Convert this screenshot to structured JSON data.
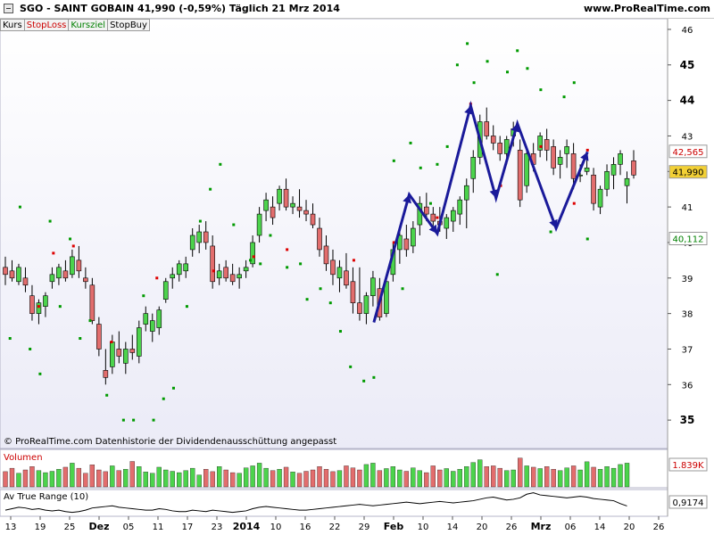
{
  "header": {
    "title": "SGO - SAINT GOBAIN    41,990 (-0,59%)    Täglich  21 Mrz 2014",
    "site": "www.ProRealTime.com"
  },
  "tabs": [
    {
      "label": "Kurs",
      "color": "#000000"
    },
    {
      "label": "StopLoss",
      "color": "#cc0000"
    },
    {
      "label": "Kursziel",
      "color": "#008000"
    },
    {
      "label": "StopBuy",
      "color": "#000000"
    }
  ],
  "colors": {
    "up": "#4cd34c",
    "down": "#e26d6d",
    "zigzag": "#1a1a9a",
    "stop_dot": "#009a00",
    "red_dot": "#dd0000",
    "panel_bg": "#ebebf7",
    "atr_line": "#000000"
  },
  "chart_data": {
    "type": "candlestick",
    "price_axis": {
      "ticks": [
        35,
        36,
        37,
        38,
        39,
        40,
        41,
        42,
        43,
        44,
        45,
        46
      ],
      "bold_ticks": [
        35,
        44,
        45
      ],
      "range": [
        34.2,
        46.3
      ]
    },
    "x_labels": [
      "13",
      "19",
      "25",
      "Dez",
      "05",
      "11",
      "17",
      "23",
      "2014",
      "10",
      "16",
      "22",
      "29",
      "Feb",
      "10",
      "14",
      "20",
      "26",
      "Mrz",
      "06",
      "14",
      "20",
      "26"
    ],
    "bold_x_labels": [
      "Dez",
      "2014",
      "Feb",
      "Mrz"
    ],
    "price_labels": [
      {
        "text": "42,565",
        "value": 42.565,
        "color": "#cc0000",
        "bg": "#ffffff"
      },
      {
        "text": "41,990",
        "value": 41.99,
        "color": "#000000",
        "bg": "#f2d035"
      },
      {
        "text": "40,112",
        "value": 40.112,
        "color": "#008000",
        "bg": "#ffffff"
      }
    ],
    "candles": [
      [
        39.3,
        39.6,
        38.8,
        39.1
      ],
      [
        39.2,
        39.5,
        38.9,
        39.0
      ],
      [
        38.9,
        39.4,
        38.8,
        39.3
      ],
      [
        39.0,
        39.3,
        38.6,
        38.8
      ],
      [
        38.5,
        38.8,
        37.8,
        38.0
      ],
      [
        38.0,
        38.4,
        37.7,
        38.3
      ],
      [
        38.2,
        38.6,
        37.9,
        38.5
      ],
      [
        38.9,
        39.3,
        38.7,
        39.1
      ],
      [
        39.0,
        39.4,
        38.8,
        39.3
      ],
      [
        39.2,
        39.5,
        38.9,
        39.0
      ],
      [
        39.1,
        39.8,
        39.0,
        39.6
      ],
      [
        39.5,
        39.9,
        39.0,
        39.2
      ],
      [
        39.0,
        39.3,
        38.7,
        38.9
      ],
      [
        38.8,
        39.0,
        37.7,
        37.8
      ],
      [
        37.7,
        37.9,
        36.8,
        37.0
      ],
      [
        36.4,
        37.0,
        36.0,
        36.2
      ],
      [
        36.5,
        37.4,
        36.3,
        37.2
      ],
      [
        37.0,
        37.5,
        36.6,
        36.8
      ],
      [
        36.6,
        37.2,
        36.3,
        37.0
      ],
      [
        37.0,
        37.4,
        36.7,
        36.9
      ],
      [
        36.8,
        37.8,
        36.6,
        37.6
      ],
      [
        37.7,
        38.2,
        37.5,
        38.0
      ],
      [
        37.5,
        38.0,
        37.2,
        37.8
      ],
      [
        37.6,
        38.2,
        37.4,
        38.1
      ],
      [
        38.4,
        39.0,
        38.3,
        38.9
      ],
      [
        39.0,
        39.3,
        38.7,
        39.1
      ],
      [
        39.1,
        39.5,
        38.9,
        39.4
      ],
      [
        39.2,
        39.6,
        39.0,
        39.4
      ],
      [
        39.8,
        40.4,
        39.6,
        40.2
      ],
      [
        40.0,
        40.5,
        39.7,
        40.3
      ],
      [
        40.3,
        40.6,
        39.8,
        40.0
      ],
      [
        39.9,
        40.2,
        38.7,
        38.9
      ],
      [
        39.0,
        39.4,
        38.8,
        39.2
      ],
      [
        39.3,
        39.5,
        38.9,
        39.0
      ],
      [
        39.1,
        39.4,
        38.8,
        38.9
      ],
      [
        39.0,
        39.3,
        38.7,
        39.1
      ],
      [
        39.2,
        39.5,
        39.0,
        39.3
      ],
      [
        39.4,
        40.2,
        39.3,
        40.0
      ],
      [
        40.2,
        41.0,
        40.0,
        40.8
      ],
      [
        40.9,
        41.4,
        40.6,
        41.2
      ],
      [
        41.0,
        41.3,
        40.5,
        40.7
      ],
      [
        41.1,
        41.6,
        40.9,
        41.5
      ],
      [
        41.5,
        41.8,
        40.9,
        41.0
      ],
      [
        41.0,
        41.3,
        40.8,
        41.1
      ],
      [
        41.0,
        41.5,
        40.7,
        40.9
      ],
      [
        40.9,
        41.2,
        40.6,
        40.8
      ],
      [
        40.8,
        41.1,
        40.4,
        40.5
      ],
      [
        40.4,
        40.7,
        39.6,
        39.8
      ],
      [
        39.9,
        40.2,
        39.2,
        39.4
      ],
      [
        39.5,
        39.8,
        38.8,
        39.1
      ],
      [
        39.0,
        39.5,
        38.6,
        39.3
      ],
      [
        39.2,
        39.7,
        38.7,
        38.8
      ],
      [
        38.9,
        39.3,
        38.0,
        38.3
      ],
      [
        38.3,
        39.3,
        37.8,
        38.0
      ],
      [
        38.0,
        38.6,
        37.7,
        38.5
      ],
      [
        38.5,
        39.2,
        38.2,
        39.0
      ],
      [
        38.7,
        39.0,
        37.8,
        37.9
      ],
      [
        38.0,
        39.1,
        37.9,
        38.9
      ],
      [
        39.1,
        40.0,
        38.9,
        39.8
      ],
      [
        39.8,
        40.4,
        39.4,
        40.2
      ],
      [
        40.1,
        40.5,
        39.6,
        39.8
      ],
      [
        39.9,
        40.6,
        39.7,
        40.4
      ],
      [
        40.5,
        41.3,
        40.2,
        41.1
      ],
      [
        41.0,
        41.4,
        40.6,
        40.8
      ],
      [
        40.8,
        41.0,
        40.4,
        40.6
      ],
      [
        40.6,
        41.0,
        40.3,
        40.5
      ],
      [
        40.4,
        40.8,
        40.1,
        40.7
      ],
      [
        40.6,
        41.0,
        40.3,
        40.9
      ],
      [
        40.8,
        41.3,
        40.5,
        41.2
      ],
      [
        41.2,
        41.8,
        40.4,
        41.6
      ],
      [
        41.8,
        42.6,
        41.4,
        42.4
      ],
      [
        42.4,
        43.6,
        42.2,
        43.4
      ],
      [
        43.4,
        43.8,
        42.9,
        43.0
      ],
      [
        43.0,
        43.3,
        42.6,
        42.8
      ],
      [
        42.8,
        43.0,
        42.3,
        42.5
      ],
      [
        42.5,
        43.0,
        42.2,
        42.9
      ],
      [
        43.0,
        43.4,
        42.7,
        43.2
      ],
      [
        42.6,
        42.9,
        41.0,
        41.2
      ],
      [
        41.6,
        42.7,
        41.4,
        42.5
      ],
      [
        42.5,
        42.8,
        42.0,
        42.2
      ],
      [
        42.6,
        43.1,
        42.4,
        43.0
      ],
      [
        42.9,
        43.2,
        42.3,
        42.6
      ],
      [
        42.7,
        42.9,
        41.9,
        42.1
      ],
      [
        42.2,
        42.6,
        41.8,
        42.4
      ],
      [
        42.5,
        42.9,
        42.1,
        42.7
      ],
      [
        42.5,
        42.8,
        41.5,
        41.8
      ],
      [
        41.9,
        42.2,
        41.7,
        41.9
      ],
      [
        42.0,
        42.4,
        41.9,
        42.1
      ],
      [
        41.9,
        42.1,
        40.9,
        41.1
      ],
      [
        41.0,
        41.6,
        40.8,
        41.5
      ],
      [
        41.5,
        42.2,
        41.3,
        42.0
      ],
      [
        41.9,
        42.4,
        41.5,
        42.2
      ],
      [
        42.2,
        42.6,
        41.9,
        42.5
      ],
      [
        41.6,
        42.0,
        41.1,
        41.8
      ],
      [
        42.3,
        42.6,
        41.8,
        41.9
      ]
    ],
    "zigzag": [
      [
        0.56,
        37.75
      ],
      [
        0.613,
        41.35
      ],
      [
        0.655,
        40.25
      ],
      [
        0.705,
        43.85
      ],
      [
        0.743,
        41.25
      ],
      [
        0.775,
        43.35
      ],
      [
        0.833,
        40.4
      ],
      [
        0.88,
        42.55
      ]
    ],
    "stop_dots": [
      [
        0.015,
        37.3
      ],
      [
        0.03,
        41.0
      ],
      [
        0.045,
        37.0
      ],
      [
        0.06,
        36.3
      ],
      [
        0.075,
        40.6
      ],
      [
        0.09,
        38.2
      ],
      [
        0.105,
        40.1
      ],
      [
        0.12,
        37.3
      ],
      [
        0.135,
        37.8
      ],
      [
        0.16,
        35.7
      ],
      [
        0.185,
        35.0
      ],
      [
        0.2,
        35.0
      ],
      [
        0.215,
        38.5
      ],
      [
        0.23,
        35.0
      ],
      [
        0.245,
        35.6
      ],
      [
        0.26,
        35.9
      ],
      [
        0.28,
        38.2
      ],
      [
        0.3,
        40.6
      ],
      [
        0.315,
        41.5
      ],
      [
        0.33,
        42.2
      ],
      [
        0.35,
        40.5
      ],
      [
        0.375,
        39.5
      ],
      [
        0.39,
        39.4
      ],
      [
        0.405,
        40.2
      ],
      [
        0.43,
        39.3
      ],
      [
        0.45,
        39.4
      ],
      [
        0.46,
        38.4
      ],
      [
        0.48,
        38.7
      ],
      [
        0.495,
        38.3
      ],
      [
        0.51,
        37.5
      ],
      [
        0.525,
        36.5
      ],
      [
        0.545,
        36.1
      ],
      [
        0.56,
        36.2
      ],
      [
        0.59,
        42.3
      ],
      [
        0.603,
        38.7
      ],
      [
        0.615,
        42.8
      ],
      [
        0.63,
        42.1
      ],
      [
        0.645,
        41.1
      ],
      [
        0.655,
        42.2
      ],
      [
        0.67,
        42.7
      ],
      [
        0.685,
        45.0
      ],
      [
        0.7,
        45.6
      ],
      [
        0.71,
        44.5
      ],
      [
        0.73,
        45.1
      ],
      [
        0.745,
        39.1
      ],
      [
        0.76,
        44.8
      ],
      [
        0.775,
        45.4
      ],
      [
        0.79,
        44.9
      ],
      [
        0.81,
        44.3
      ],
      [
        0.825,
        40.3
      ],
      [
        0.845,
        44.1
      ],
      [
        0.86,
        44.5
      ],
      [
        0.88,
        40.1
      ]
    ],
    "red_dots": [
      [
        0.058,
        38.2
      ],
      [
        0.08,
        39.7
      ],
      [
        0.11,
        39.9
      ],
      [
        0.167,
        37.2
      ],
      [
        0.235,
        39.0
      ],
      [
        0.32,
        39.2
      ],
      [
        0.38,
        39.6
      ],
      [
        0.43,
        39.8
      ],
      [
        0.53,
        39.5
      ],
      [
        0.59,
        40.0
      ],
      [
        0.655,
        40.7
      ],
      [
        0.705,
        43.9
      ],
      [
        0.75,
        41.6
      ],
      [
        0.81,
        42.7
      ],
      [
        0.86,
        41.1
      ],
      [
        0.88,
        42.6
      ]
    ],
    "copyright": "© ProRealTime.com  Datenhistorie der Dividendenausschüttung angepasst",
    "volume": {
      "label": "Volumen",
      "value_label": "1.839K",
      "values": [
        0.45,
        0.55,
        0.4,
        0.5,
        0.6,
        0.48,
        0.42,
        0.46,
        0.52,
        0.58,
        0.7,
        0.55,
        0.4,
        0.65,
        0.5,
        0.45,
        0.62,
        0.48,
        0.52,
        0.75,
        0.6,
        0.44,
        0.4,
        0.58,
        0.5,
        0.46,
        0.42,
        0.48,
        0.55,
        0.35,
        0.52,
        0.45,
        0.6,
        0.5,
        0.42,
        0.4,
        0.56,
        0.62,
        0.7,
        0.55,
        0.48,
        0.52,
        0.58,
        0.44,
        0.4,
        0.46,
        0.5,
        0.6,
        0.52,
        0.45,
        0.48,
        0.62,
        0.56,
        0.5,
        0.66,
        0.7,
        0.48,
        0.54,
        0.6,
        0.5,
        0.46,
        0.56,
        0.48,
        0.42,
        0.62,
        0.5,
        0.54,
        0.46,
        0.52,
        0.6,
        0.72,
        0.8,
        0.6,
        0.62,
        0.55,
        0.48,
        0.5,
        0.85,
        0.62,
        0.58,
        0.54,
        0.6,
        0.52,
        0.48,
        0.56,
        0.62,
        0.5,
        0.74,
        0.58,
        0.52,
        0.6,
        0.55,
        0.66,
        0.7
      ]
    },
    "atr": {
      "label": "Av True Range (10)",
      "value_label": "0,9174",
      "values": [
        0.86,
        0.88,
        0.9,
        0.89,
        0.87,
        0.88,
        0.86,
        0.85,
        0.86,
        0.84,
        0.83,
        0.84,
        0.86,
        0.89,
        0.9,
        0.91,
        0.92,
        0.9,
        0.89,
        0.88,
        0.87,
        0.86,
        0.86,
        0.88,
        0.87,
        0.85,
        0.84,
        0.84,
        0.86,
        0.85,
        0.84,
        0.86,
        0.85,
        0.84,
        0.83,
        0.84,
        0.85,
        0.88,
        0.9,
        0.91,
        0.9,
        0.89,
        0.88,
        0.87,
        0.86,
        0.86,
        0.87,
        0.88,
        0.89,
        0.9,
        0.91,
        0.92,
        0.93,
        0.94,
        0.93,
        0.92,
        0.93,
        0.94,
        0.95,
        0.96,
        0.97,
        0.96,
        0.95,
        0.96,
        0.97,
        0.98,
        0.97,
        0.96,
        0.97,
        0.98,
        0.99,
        1.01,
        1.03,
        1.04,
        1.02,
        1.0,
        1.01,
        1.03,
        1.08,
        1.1,
        1.07,
        1.06,
        1.05,
        1.04,
        1.03,
        1.04,
        1.05,
        1.04,
        1.02,
        1.01,
        1.0,
        0.99,
        0.95,
        0.9174
      ]
    }
  }
}
